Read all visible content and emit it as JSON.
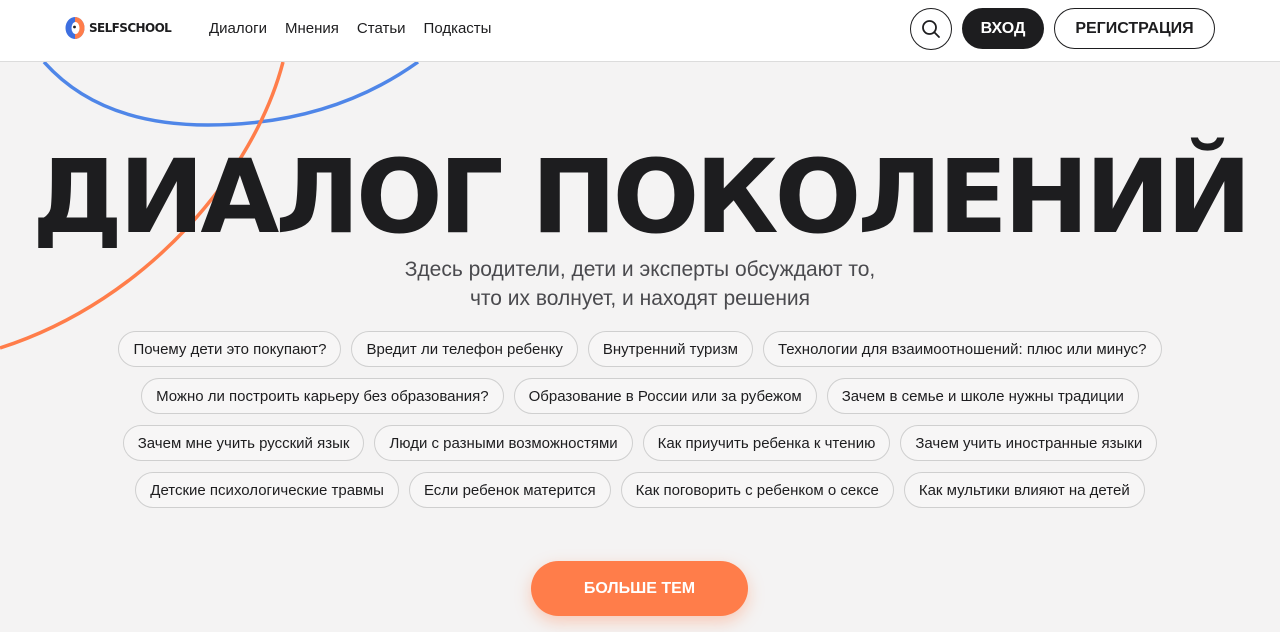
{
  "header": {
    "logo_text": "SELFSCHOOL",
    "nav": [
      "Диалоги",
      "Мнения",
      "Статьи",
      "Подкасты"
    ],
    "login_label": "ВХОД",
    "register_label": "РЕГИСТРАЦИЯ"
  },
  "hero": {
    "title": "ДИАЛОГ ПОКОЛЕНИЙ",
    "subtitle_line1": "Здесь родители, дети и эксперты обсуждают то,",
    "subtitle_line2": "что их волнует, и находят решения"
  },
  "tags": [
    [
      "Почему дети это покупают?",
      "Вредит ли телефон ребенку",
      "Внутренний туризм",
      "Технологии для взаимоотношений: плюс или минус?"
    ],
    [
      "Можно ли построить карьеру без образования?",
      "Образование в России или за рубежом",
      "Зачем в семье и школе нужны традиции"
    ],
    [
      "Зачем мне учить русский язык",
      "Люди с разными возможностями",
      "Как приучить ребенка к чтению",
      "Зачем учить иностранные языки"
    ],
    [
      "Детские психологические травмы",
      "Если ребенок матерится",
      "Как поговорить с ребенком о сексе",
      "Как мультики влияют на детей"
    ]
  ],
  "more_label": "БОЛЬШЕ ТЕМ",
  "colors": {
    "accent": "#ff7d4a",
    "blue_arc": "#4f86e8",
    "dark": "#1d1d1f",
    "background": "#f4f3f3"
  },
  "icons": {
    "search": "search-icon",
    "logo": "logo-icon"
  }
}
